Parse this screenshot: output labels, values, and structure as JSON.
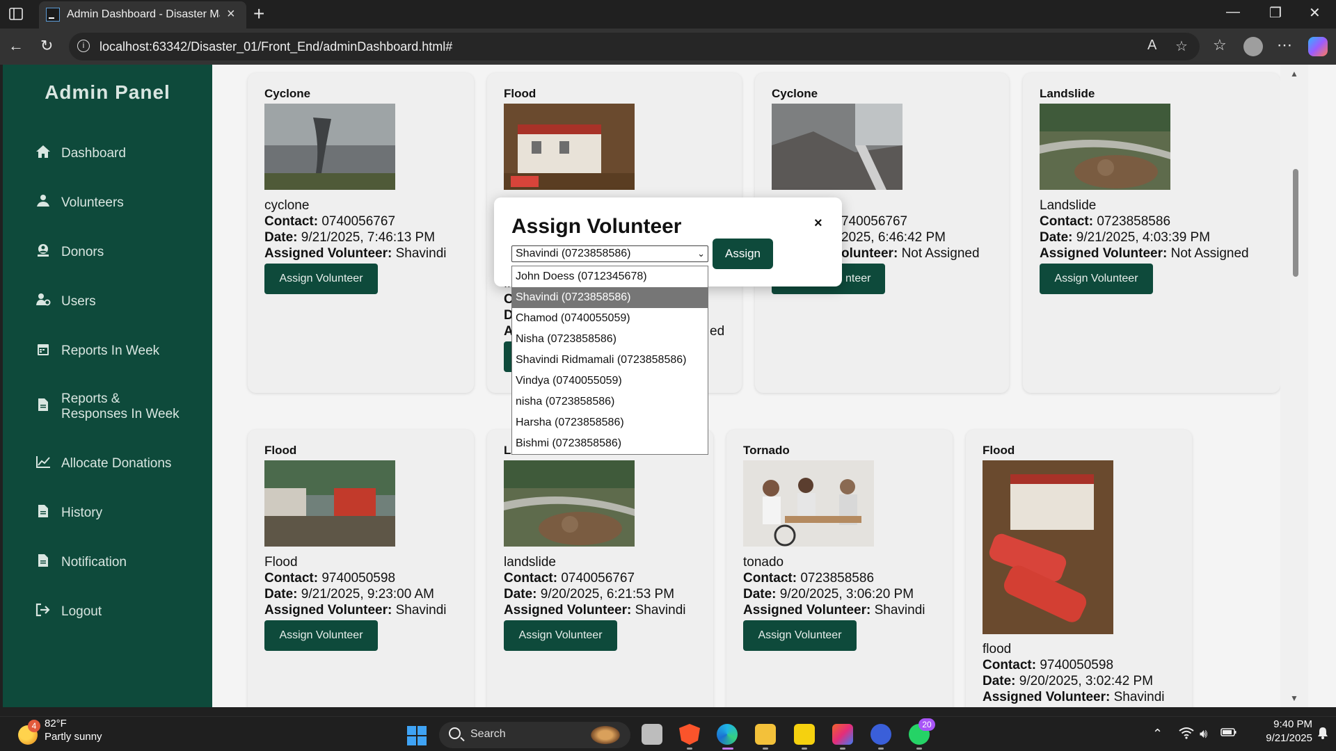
{
  "browser": {
    "tab_title": "Admin Dashboard - Disaster Man",
    "url": "localhost:63342/Disaster_01/Front_End/adminDashboard.html#"
  },
  "sidebar": {
    "title": "Admin Panel",
    "items": [
      {
        "label": "Dashboard",
        "icon": "home-icon"
      },
      {
        "label": "Volunteers",
        "icon": "volunteer-icon"
      },
      {
        "label": "Donors",
        "icon": "donor-icon"
      },
      {
        "label": "Users",
        "icon": "users-icon"
      },
      {
        "label": "Reports In Week",
        "icon": "calendar-icon"
      },
      {
        "label": "Reports & Responses In Week",
        "label_line1": "Reports &",
        "label_line2": "Responses In Week",
        "icon": "document-icon"
      },
      {
        "label": "Allocate Donations",
        "icon": "chart-icon"
      },
      {
        "label": "History",
        "icon": "document-icon"
      },
      {
        "label": "Notification",
        "icon": "document-icon"
      },
      {
        "label": "Logout",
        "icon": "logout-icon"
      }
    ]
  },
  "field_labels": {
    "contact": "Contact:",
    "date": "Date:",
    "assigned": "Assigned Volunteer:"
  },
  "assign_button_label": "Assign Volunteer",
  "cards": [
    {
      "type": "Cyclone",
      "desc": "cyclone",
      "contact": "0740056767",
      "date": "9/21/2025, 7:46:13 PM",
      "assigned": "Shavindi"
    },
    {
      "type": "Flood",
      "desc": "fl",
      "contact": "",
      "date": "",
      "assigned": "",
      "partial_end": "ed"
    },
    {
      "type": "Cyclone",
      "desc": "",
      "contact": "740056767",
      "date": "2025, 6:46:42 PM",
      "assigned": "Not Assigned",
      "btn_partial": "nteer"
    },
    {
      "type": "Landslide",
      "desc": "Landslide",
      "contact": "0723858586",
      "date": "9/21/2025, 4:03:39 PM",
      "assigned": "Not Assigned"
    },
    {
      "type": "Flood",
      "desc": "Flood",
      "contact": "9740050598",
      "date": "9/21/2025, 9:23:00 AM",
      "assigned": "Shavindi"
    },
    {
      "type": "Landslide",
      "desc": "landslide",
      "contact": "0740056767",
      "date": "9/20/2025, 6:21:53 PM",
      "assigned": "Shavindi"
    },
    {
      "type": "Tornado",
      "desc": "tonado",
      "contact": "0723858586",
      "date": "9/20/2025, 3:06:20 PM",
      "assigned": "Shavindi"
    },
    {
      "type": "Flood",
      "desc": "flood",
      "contact": "9740050598",
      "date": "9/20/2025, 3:02:42 PM",
      "assigned": "Shavindi"
    }
  ],
  "modal": {
    "title": "Assign Volunteer",
    "close": "×",
    "selected": "Shavindi (0723858586)",
    "assign_label": "Assign",
    "options": [
      "John Doess (0712345678)",
      "Shavindi (0723858586)",
      "Chamod (0740055059)",
      "Nisha (0723858586)",
      "Shavindi Ridmamali (0723858586)",
      "Vindya (0740055059)",
      "nisha (0723858586)",
      "Harsha (0723858586)",
      "Bishmi (0723858586)"
    ],
    "highlighted_option_index": 1
  },
  "taskbar": {
    "weather_temp": "82°F",
    "weather_desc": "Partly sunny",
    "weather_badge": "4",
    "search_label": "Search",
    "whatsapp_badge": "20",
    "time": "9:40 PM",
    "date": "9/21/2025"
  },
  "colors": {
    "sidebar": "#0e4a3b",
    "button": "#0e4a3b"
  }
}
